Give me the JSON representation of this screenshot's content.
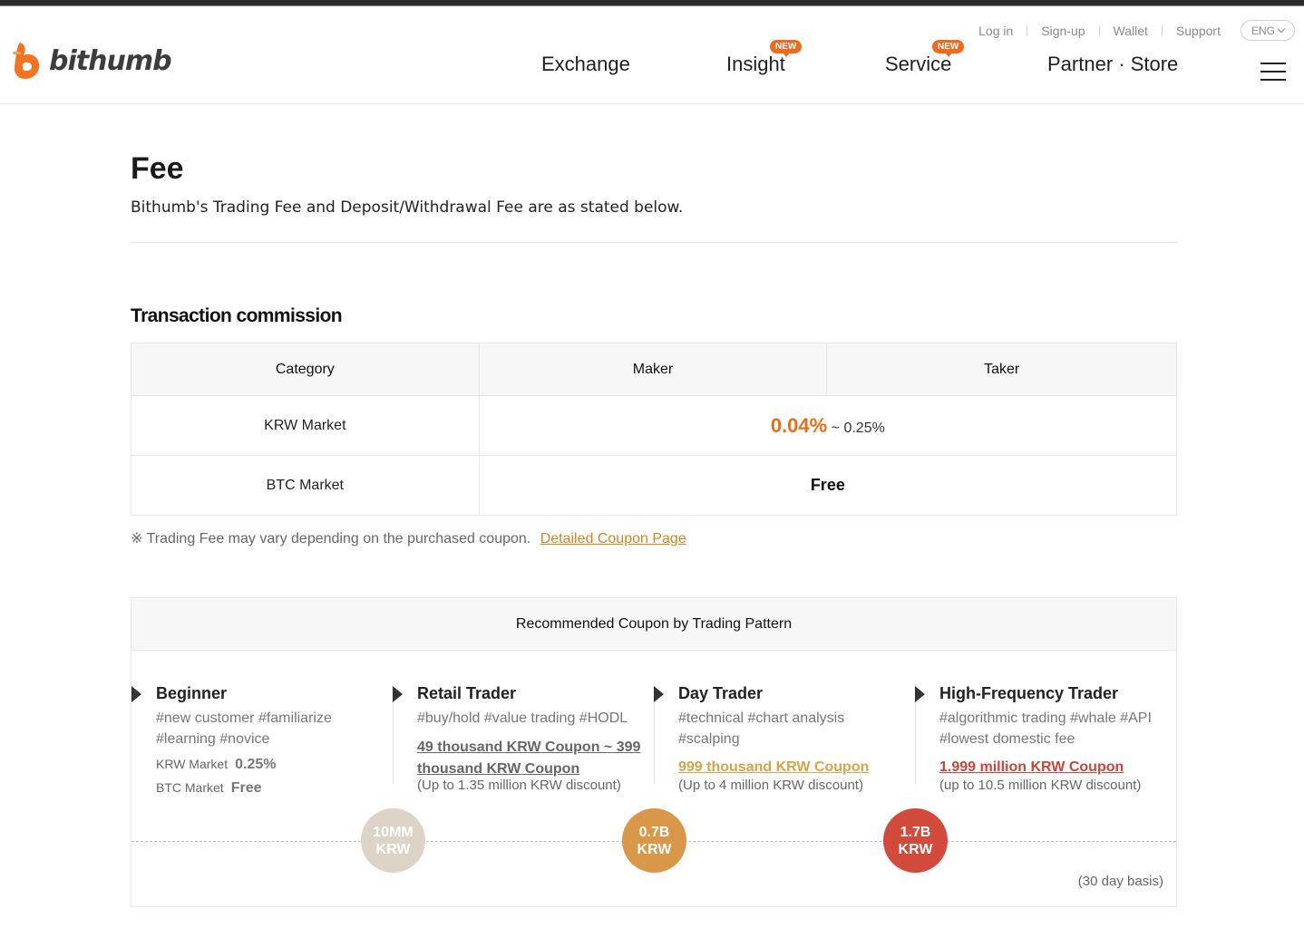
{
  "header": {
    "logo_text": "bithumb",
    "util_links": [
      "Log in",
      "Sign-up",
      "Wallet",
      "Support"
    ],
    "language": "ENG",
    "nav": [
      {
        "label": "Exchange",
        "badge": ""
      },
      {
        "label": "Insight",
        "badge": "NEW"
      },
      {
        "label": "Service",
        "badge": "NEW"
      },
      {
        "label": "Partner · Store",
        "badge": ""
      }
    ]
  },
  "page": {
    "title": "Fee",
    "description": "Bithumb's Trading Fee and Deposit/Withdrawal Fee are as stated below."
  },
  "transaction": {
    "title": "Transaction commission",
    "headers": [
      "Category",
      "Maker",
      "Taker"
    ],
    "rows": [
      {
        "category": "KRW Market",
        "rate_highlight": "0.04%",
        "rate_rest": "~ 0.25%"
      },
      {
        "category": "BTC Market",
        "rate_text": "Free"
      }
    ],
    "note": "※ Trading Fee may vary depending on the purchased coupon.",
    "note_link": "Detailed Coupon Page"
  },
  "coupons": {
    "title": "Recommended Coupon by Trading Pattern",
    "columns": [
      {
        "title": "Beginner",
        "tags": "#new customer #familiarize #learning #novice",
        "krw_label": "KRW Market",
        "krw_value": "0.25%",
        "btc_label": "BTC Market",
        "btc_value": "Free"
      },
      {
        "title": "Retail Trader",
        "tags": "#buy/hold #value trading #HODL",
        "coupon": "49 thousand KRW Coupon ~ 399 thousand KRW Coupon",
        "discount": "(Up to 1.35 million KRW discount)",
        "coupon_color": "#666666"
      },
      {
        "title": "Day Trader",
        "tags": "#technical #chart analysis #scalping",
        "coupon": "999 thousand KRW Coupon",
        "discount": "(Up to 4 million KRW discount)",
        "coupon_color": "#d8a24a"
      },
      {
        "title": "High-Frequency Trader",
        "tags": "#algorithmic trading #whale #API #lowest domestic fee",
        "coupon": "1.999 million KRW Coupon",
        "discount": "(up to 10.5 million KRW discount)",
        "coupon_color": "#c9453a"
      }
    ],
    "thresholds": [
      {
        "line1": "10MM",
        "line2": "KRW",
        "color": "#ddd3c6"
      },
      {
        "line1": "0.7B",
        "line2": "KRW",
        "color": "#d9974a"
      },
      {
        "line1": "1.7B",
        "line2": "KRW",
        "color": "#d24a3c"
      }
    ],
    "basis": "(30 day basis)"
  },
  "colors": {
    "brand_orange": "#f37321",
    "accent_orange": "#e86f17",
    "badge": "#ee6a1e"
  }
}
